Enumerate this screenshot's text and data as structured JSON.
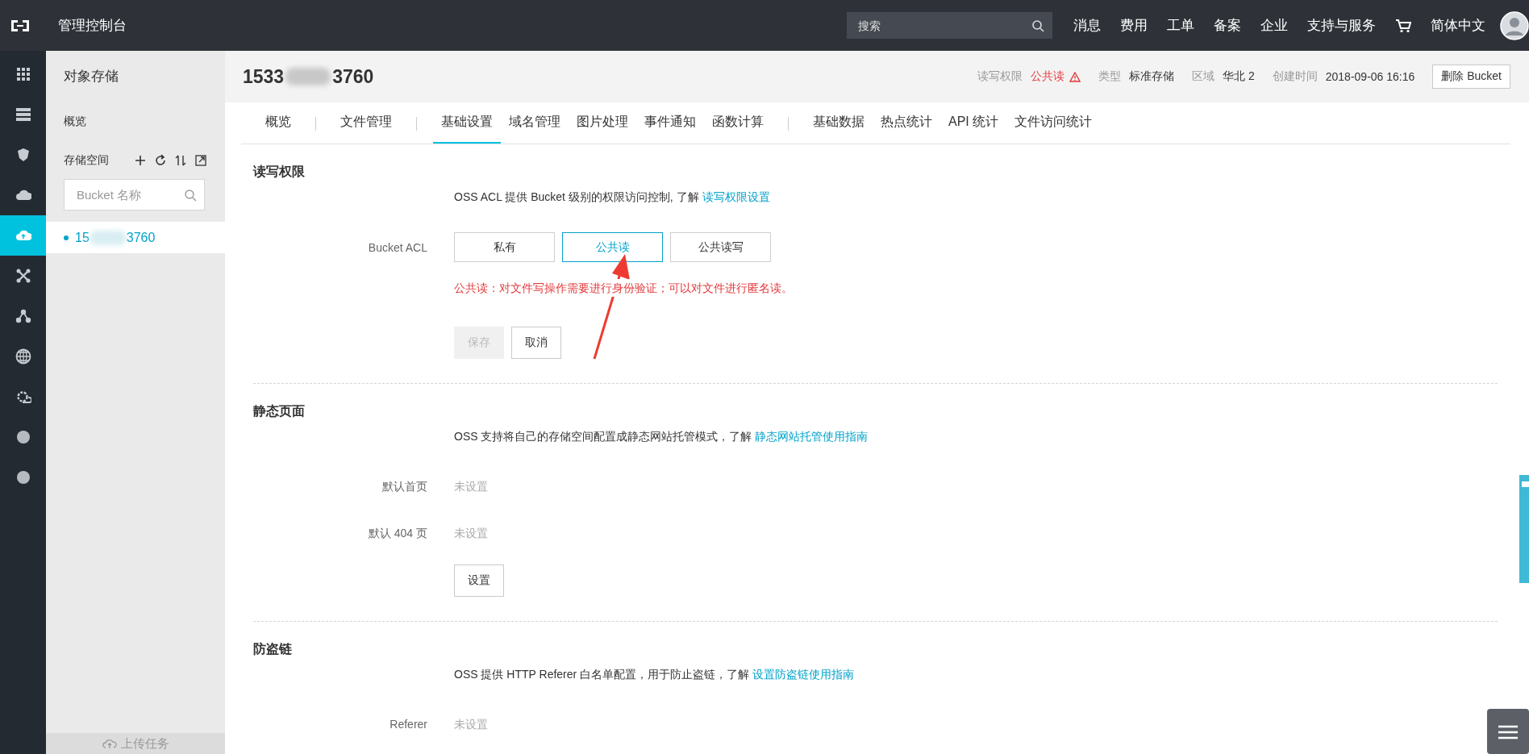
{
  "topbar": {
    "console_title": "管理控制台",
    "search": {
      "placeholder": "搜索"
    },
    "nav": [
      "消息",
      "费用",
      "工单",
      "备案",
      "企业",
      "支持与服务"
    ],
    "language": "简体中文"
  },
  "rail": {
    "items": [
      {
        "kind": "grid",
        "selected": false
      },
      {
        "kind": "server",
        "selected": false
      },
      {
        "kind": "shield",
        "selected": false
      },
      {
        "kind": "cloud",
        "selected": false
      },
      {
        "kind": "upload",
        "selected": true
      },
      {
        "kind": "cross",
        "selected": false
      },
      {
        "kind": "nodes",
        "selected": false
      },
      {
        "kind": "globe",
        "selected": false
      },
      {
        "kind": "gear",
        "selected": false
      },
      {
        "kind": "dot",
        "selected": false
      },
      {
        "kind": "dot",
        "selected": false
      }
    ]
  },
  "sidebar": {
    "title": "对象存储",
    "overview": "概览",
    "buckets_label": "存储空间",
    "search": {
      "placeholder": "Bucket 名称"
    },
    "buckets": [
      {
        "name_start": "15",
        "name_end": "3760",
        "selected": true
      }
    ],
    "upload_tasks": "上传任务"
  },
  "header": {
    "name_start": "1533",
    "name_end": "3760",
    "meta": [
      {
        "label": "读写权限",
        "value": "公共读",
        "warning": true
      },
      {
        "label": "类型",
        "value": "标准存储",
        "warning": false
      },
      {
        "label": "区域",
        "value": "华北 2",
        "warning": false
      },
      {
        "label": "创建时间",
        "value": "2018-09-06 16:16",
        "warning": false
      }
    ],
    "delete_button": "删除 Bucket"
  },
  "tab_groups": [
    [
      {
        "label": "概览",
        "selected": false
      }
    ],
    [
      {
        "label": "文件管理",
        "selected": false
      }
    ],
    [
      {
        "label": "基础设置",
        "selected": true
      },
      {
        "label": "域名管理",
        "selected": false
      },
      {
        "label": "图片处理",
        "selected": false
      },
      {
        "label": "事件通知",
        "selected": false
      },
      {
        "label": "函数计算",
        "selected": false
      }
    ],
    [
      {
        "label": "基础数据",
        "selected": false
      },
      {
        "label": "热点统计",
        "selected": false
      },
      {
        "label": "API 统计",
        "selected": false
      },
      {
        "label": "文件访问统计",
        "selected": false
      }
    ]
  ],
  "sections": [
    {
      "title": "读写权限",
      "description": "OSS ACL 提供 Bucket 级别的权限访问控制, 了解 ",
      "link": "读写权限设置",
      "rows": [
        {
          "kind": "options",
          "label": "Bucket ACL",
          "options": [
            {
              "label": "私有",
              "selected": false
            },
            {
              "label": "公共读",
              "selected": true
            },
            {
              "label": "公共读写",
              "selected": false
            }
          ]
        },
        {
          "kind": "error",
          "text": "公共读：对文件写操作需要进行身份验证；可以对文件进行匿名读。"
        },
        {
          "kind": "actions",
          "buttons": [
            {
              "label": "保存",
              "disabled": true
            },
            {
              "label": "取消",
              "disabled": false
            }
          ]
        }
      ]
    },
    {
      "title": "静态页面",
      "description": "OSS 支持将自己的存储空间配置成静态网站托管模式，了解 ",
      "link": "静态网站托管使用指南",
      "rows": [
        {
          "kind": "value",
          "label": "默认首页",
          "value": "未设置"
        },
        {
          "kind": "value",
          "label": "默认 404 页",
          "value": "未设置"
        },
        {
          "kind": "actions",
          "buttons": [
            {
              "label": "设置",
              "disabled": false
            }
          ]
        }
      ]
    },
    {
      "title": "防盗链",
      "description": "OSS 提供 HTTP Referer 白名单配置，用于防止盗链，了解 ",
      "link": "设置防盗链使用指南",
      "rows": [
        {
          "kind": "value",
          "label": "Referer",
          "value": "未设置"
        }
      ]
    }
  ]
}
